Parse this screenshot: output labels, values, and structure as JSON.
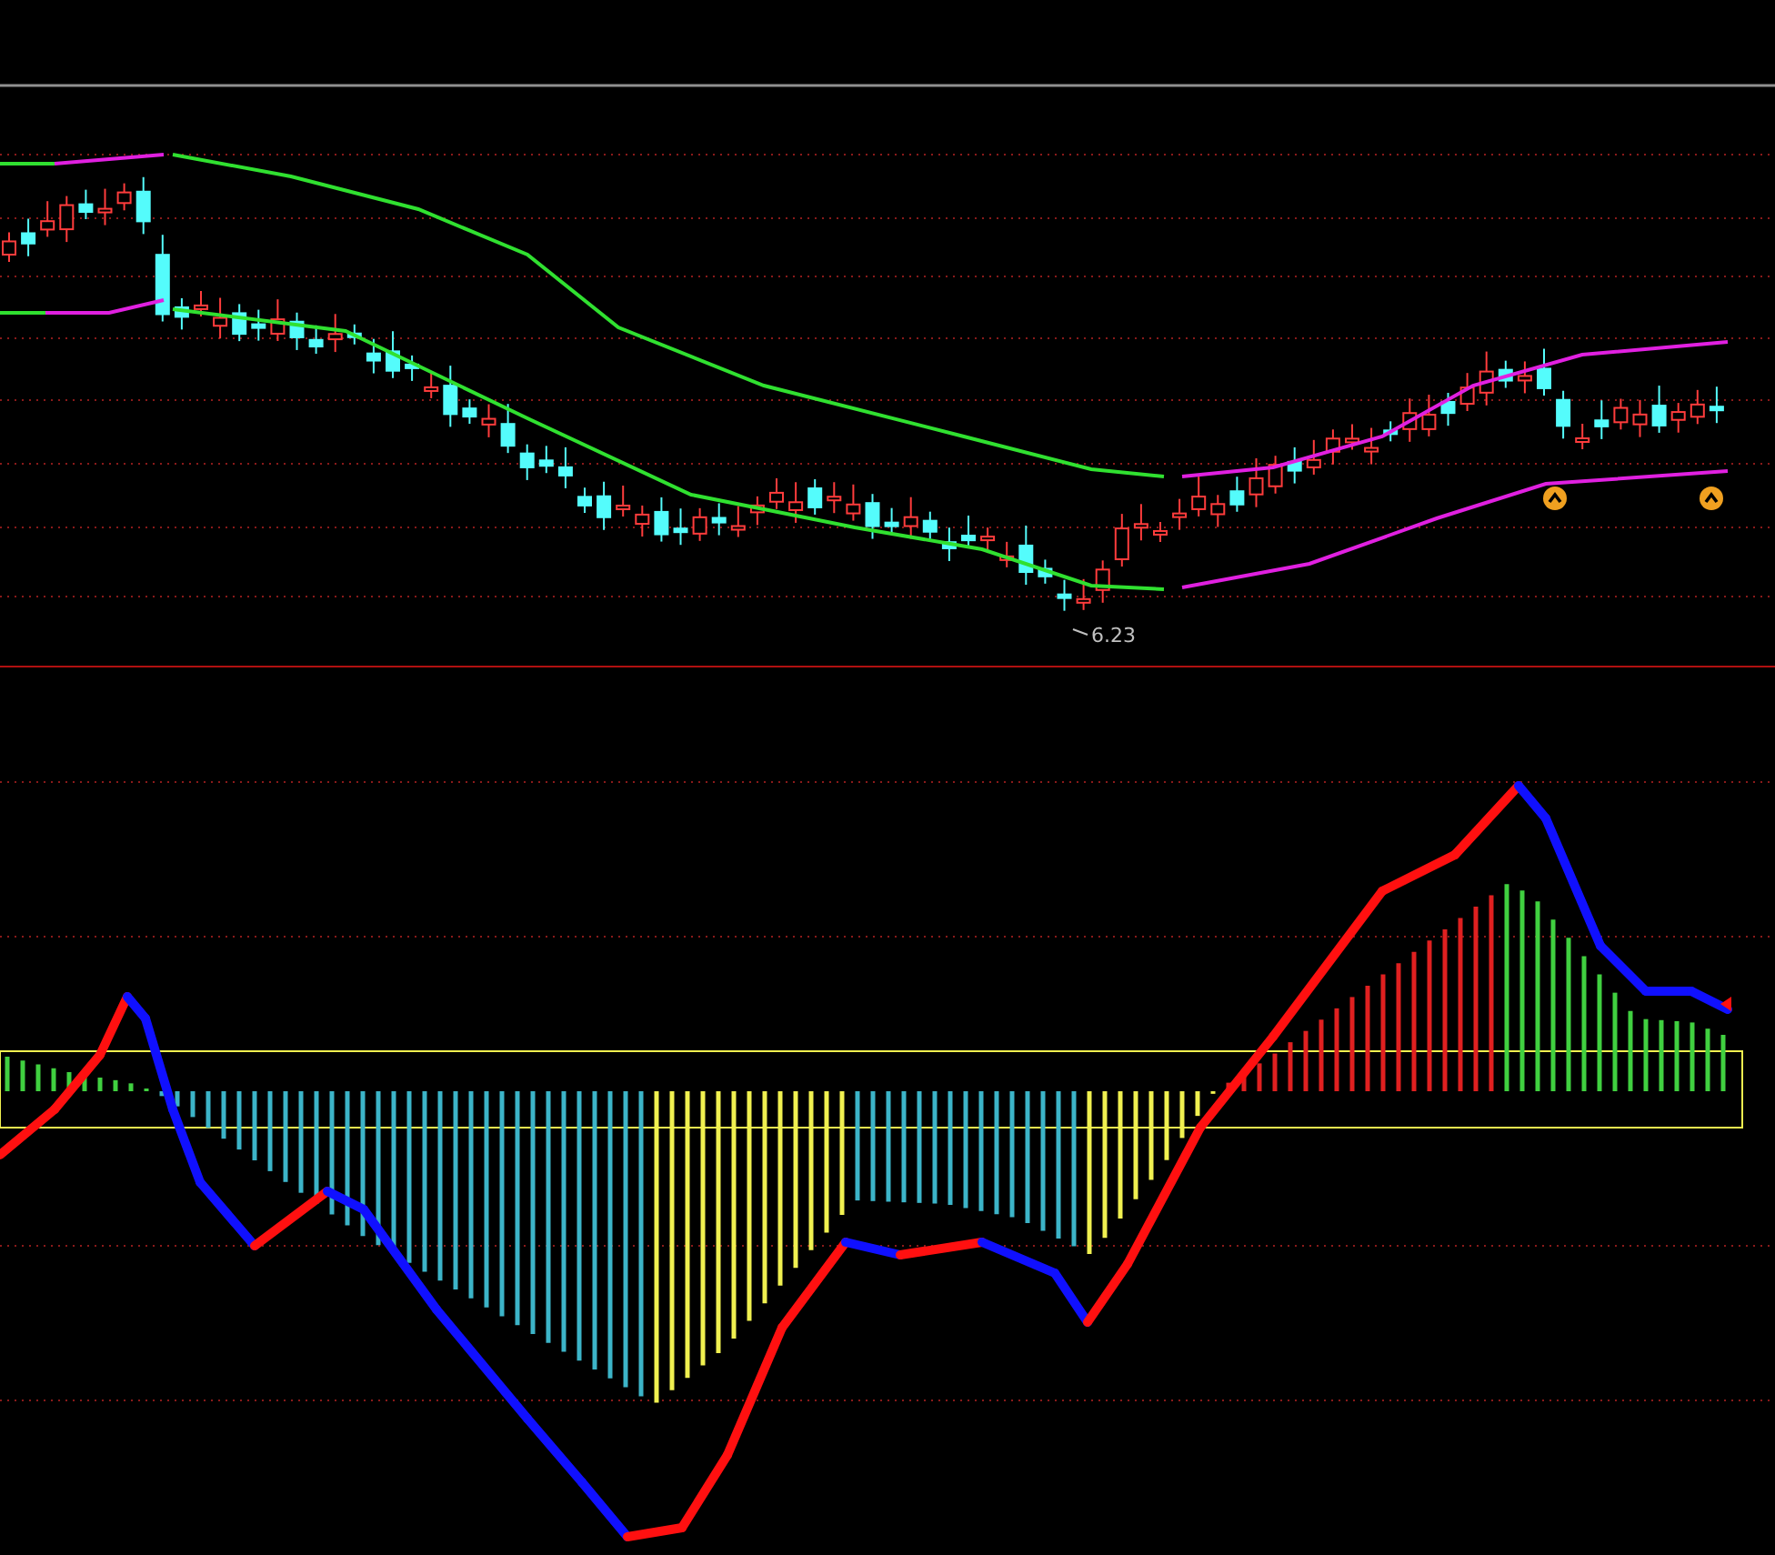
{
  "price_panel": {
    "low_label": "6.23"
  }
}
